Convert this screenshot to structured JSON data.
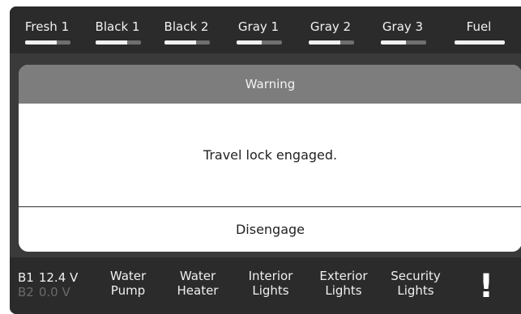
{
  "tanks": [
    {
      "label": "Fresh 1",
      "level": 0.7
    },
    {
      "label": "Black 1",
      "level": 0.7
    },
    {
      "label": "Black 2",
      "level": 0.7
    },
    {
      "label": "Gray 1",
      "level": 0.55
    },
    {
      "label": "Gray 2",
      "level": 0.7
    },
    {
      "label": "Gray 3",
      "level": 0.55
    },
    {
      "label": "Fuel",
      "level": 1.0
    }
  ],
  "dialog": {
    "title": "Warning",
    "message": "Travel lock engaged.",
    "button": "Disengage"
  },
  "battery": {
    "b1_label": "B1",
    "b1_value": "12.4 V",
    "b2_label": "B2",
    "b2_value": "0.0 V"
  },
  "controls": [
    {
      "line1": "Water",
      "line2": "Pump"
    },
    {
      "line1": "Water",
      "line2": "Heater"
    },
    {
      "line1": "Interior",
      "line2": "Lights"
    },
    {
      "line1": "Exterior",
      "line2": "Lights"
    },
    {
      "line1": "Security",
      "line2": "Lights"
    }
  ],
  "alert_symbol": "!",
  "colors": {
    "panel": "#2b2b2b",
    "dialog_header": "#7d7d7d",
    "tank_fill": "#f0f0f0"
  }
}
